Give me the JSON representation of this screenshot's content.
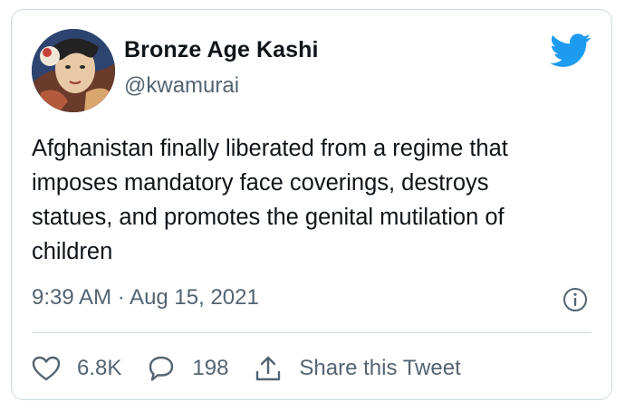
{
  "author": {
    "display_name": "Bronze Age Kashi",
    "handle": "@kwamurai"
  },
  "tweet": {
    "lines": [
      "Afghanistan finally liberated from a regime that",
      "imposes mandatory face coverings, destroys",
      "statues, and promotes the genital mutilation of",
      "children"
    ],
    "timestamp": "9:39 AM · Aug 15, 2021"
  },
  "actions": {
    "likes": "6.8K",
    "replies": "198",
    "share_label": "Share this Tweet"
  },
  "icons": {
    "brand": "twitter-bird-icon",
    "info": "info-icon",
    "like": "heart-icon",
    "reply": "speech-bubble-icon",
    "share": "share-icon"
  },
  "colors": {
    "brand_blue": "#1d9bf0",
    "text_primary": "#0f1419",
    "text_secondary": "#536471",
    "border": "#cfd9de"
  }
}
